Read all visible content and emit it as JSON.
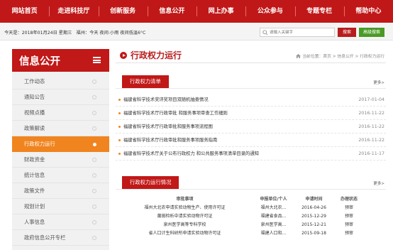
{
  "nav": {
    "items": [
      "网站首页",
      "走进科技厅",
      "创新服务",
      "信息公开",
      "网上办事",
      "公众参与",
      "专题专栏",
      "帮助中心"
    ]
  },
  "infobar": {
    "date_text": "今天是：2018年01月24日 星期三　福州：今天 夜间:小雨 夜间低温6°C",
    "search_placeholder": "请输入关键字",
    "search_label": "搜索",
    "advanced_label": "高级搜索"
  },
  "sidebar": {
    "title": "信息公开",
    "items": [
      {
        "label": "工作动态",
        "active": false
      },
      {
        "label": "通知公告",
        "active": false
      },
      {
        "label": "视频点播",
        "active": false
      },
      {
        "label": "政策解读",
        "active": false
      },
      {
        "label": "行政权力运行",
        "active": true
      },
      {
        "label": "财政资金",
        "active": false
      },
      {
        "label": "统计信息",
        "active": false
      },
      {
        "label": "政策文件",
        "active": false
      },
      {
        "label": "规划计划",
        "active": false
      },
      {
        "label": "人事信息",
        "active": false
      },
      {
        "label": "政府信息公开专栏",
        "active": false
      }
    ]
  },
  "main": {
    "title": "行政权力运行",
    "breadcrumb": "当前位置：首页 > 信息公开 > 行政权力运行",
    "list_panel": {
      "tab_label": "行政权力清单",
      "more_label": "更多>",
      "items": [
        {
          "title": "福建省科学技术奖评奖项目双随机抽查情况",
          "date": "2017-01-04"
        },
        {
          "title": "福建省科学技术厅行政审批 和服务事项审查工作细则",
          "date": "2016-11-22"
        },
        {
          "title": "福建省科学技术厅行政审批和服务事项流程图",
          "date": "2016-11-22"
        },
        {
          "title": "福建省科学技术厅行政审批和服务事项服务指南",
          "date": "2016-11-22"
        },
        {
          "title": "福建省科学技术厅关于公布行政权力 和公共服务事项清单目录的通知",
          "date": "2016-11-17"
        }
      ]
    },
    "status_panel": {
      "tab_label": "行政权力运行情况",
      "more_label": "更多>",
      "columns": [
        "审批事项",
        "申报单位/个人",
        "申请时间",
        "办理状态"
      ],
      "rows": [
        [
          "福州大北农申请实验动物生产、使用许可证",
          "福州大北农...",
          "2016-04-26",
          "预审"
        ],
        [
          "莆田检析中请实验动物许可证",
          "福建省食品...",
          "2015-12-29",
          "预审"
        ],
        [
          "泉州医学高等专科学校",
          "泉州医学高...",
          "2015-12-21",
          "预审"
        ],
        [
          "省人口计生科研所申请实验动物许可证",
          "福建人口和...",
          "2015-09-18",
          "预审"
        ]
      ]
    }
  }
}
